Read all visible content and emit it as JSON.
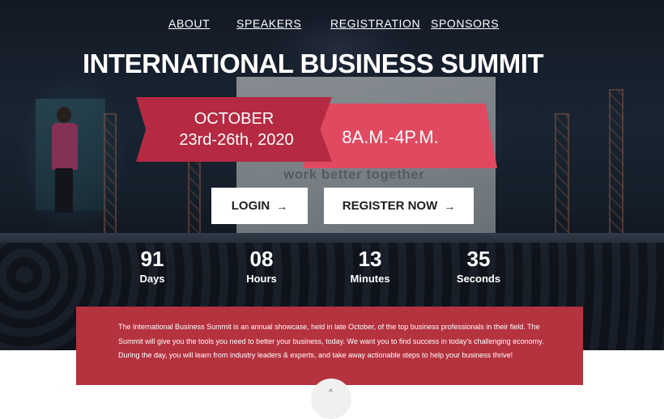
{
  "nav": {
    "items": [
      {
        "label": "ABOUT"
      },
      {
        "label": "SPEAKERS"
      },
      {
        "label": "REGISTRATION"
      },
      {
        "label": "SPONSORS"
      }
    ]
  },
  "hero": {
    "title": "INTERNATIONAL BUSINESS SUMMIT",
    "background_screen_text": "work better together",
    "date_line1": "OCTOBER",
    "date_line2": "23rd-26th, 2020",
    "time": "8A.M.-4P.M."
  },
  "buttons": {
    "login": {
      "label": "LOGIN",
      "icon": "arrow-right-icon",
      "arrow": "→"
    },
    "register": {
      "label": "REGISTER NOW",
      "icon": "arrow-right-icon",
      "arrow": "→"
    }
  },
  "countdown": [
    {
      "value": "91",
      "unit": "Days"
    },
    {
      "value": "08",
      "unit": "Hours"
    },
    {
      "value": "13",
      "unit": "Minutes"
    },
    {
      "value": "35",
      "unit": "Seconds"
    }
  ],
  "about": {
    "text": "The International Business Summit is an annual showcase, held in late October, of the top business professionals in their field. The Summit will give you the tools you need to better your business, today. We want you to find success in today's challenging economy. During the day, you will learn from industry leaders & experts, and take away actionable steps to help your business thrive!"
  },
  "scroll": {
    "icon": "chevron-down-icon",
    "glyph": "^"
  },
  "colors": {
    "ribbon_dark": "#b52a42",
    "ribbon_light": "#e04960",
    "about_bg": "#b5323f"
  }
}
